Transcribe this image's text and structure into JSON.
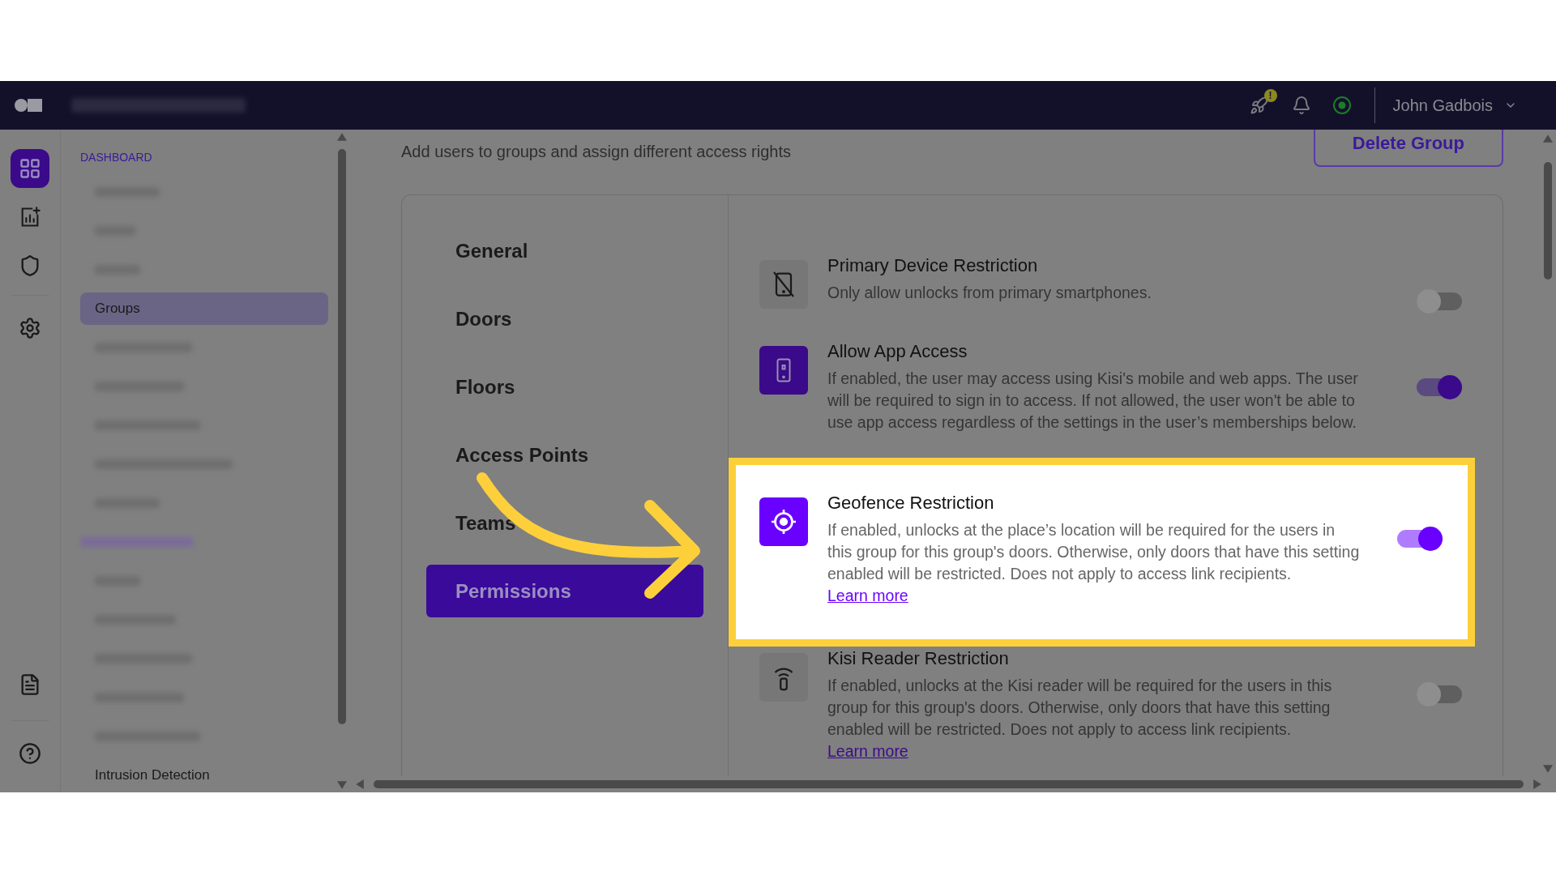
{
  "topbar": {
    "notification_badge": "!",
    "user_name": "John Gadbois"
  },
  "rail": [
    {
      "kind": "grid",
      "selected": true
    },
    {
      "kind": "chart",
      "selected": false
    },
    {
      "kind": "shield",
      "selected": false
    },
    {
      "kind": "settings",
      "selected": false
    },
    {
      "kind": "document",
      "selected": false
    },
    {
      "kind": "help",
      "selected": false
    }
  ],
  "sidebar": {
    "section_title": "DASHBOARD",
    "items": [
      {
        "kind": "redacted"
      },
      {
        "kind": "redacted"
      },
      {
        "kind": "redacted"
      },
      {
        "kind": "link",
        "label": "Groups",
        "selected": true
      },
      {
        "kind": "redacted"
      },
      {
        "kind": "redacted"
      },
      {
        "kind": "redacted"
      },
      {
        "kind": "redacted"
      },
      {
        "kind": "redacted"
      },
      {
        "kind": "heading"
      },
      {
        "kind": "redacted"
      },
      {
        "kind": "redacted"
      },
      {
        "kind": "redacted"
      },
      {
        "kind": "redacted"
      },
      {
        "kind": "redacted"
      },
      {
        "kind": "link",
        "label": "Intrusion Detection",
        "selected": false
      }
    ]
  },
  "page": {
    "subtitle": "Add users to groups and assign different access rights",
    "delete_button": "Delete Group"
  },
  "tabs": [
    {
      "label": "General",
      "selected": false
    },
    {
      "label": "Doors",
      "selected": false
    },
    {
      "label": "Floors",
      "selected": false
    },
    {
      "label": "Access Points",
      "selected": false
    },
    {
      "label": "Teams",
      "selected": false
    },
    {
      "label": "Permissions",
      "selected": true
    }
  ],
  "permissions": [
    {
      "kind": "phone-off",
      "title": "Primary Device Restriction",
      "description": "Only allow unlocks from primary smartphones.",
      "on": false,
      "highlighted": false
    },
    {
      "kind": "phone",
      "title": "Allow App Access",
      "description": "If enabled, the user may access using Kisi's mobile and web apps. The user will be required to sign in to access. If not allowed, the user won't be able to use app access regardless of the settings in the user’s memberships below.",
      "on": true,
      "highlighted": false
    },
    {
      "kind": "target",
      "title": "Geofence Restriction",
      "description": "If enabled, unlocks at the place’s location will be required for the users in this group for this group's doors. Otherwise, only doors that have this setting enabled will be restricted. Does not apply to access link recipients.",
      "link": "Learn more",
      "on": true,
      "highlighted": true
    },
    {
      "kind": "reader",
      "title": "Kisi Reader Restriction",
      "description": "If enabled, unlocks at the Kisi reader will be required for the users in this group for this group's doors. Otherwise, only doors that have this setting enabled will be restricted. Does not apply to access link recipients.",
      "link": "Learn more",
      "on": false,
      "highlighted": false
    }
  ]
}
